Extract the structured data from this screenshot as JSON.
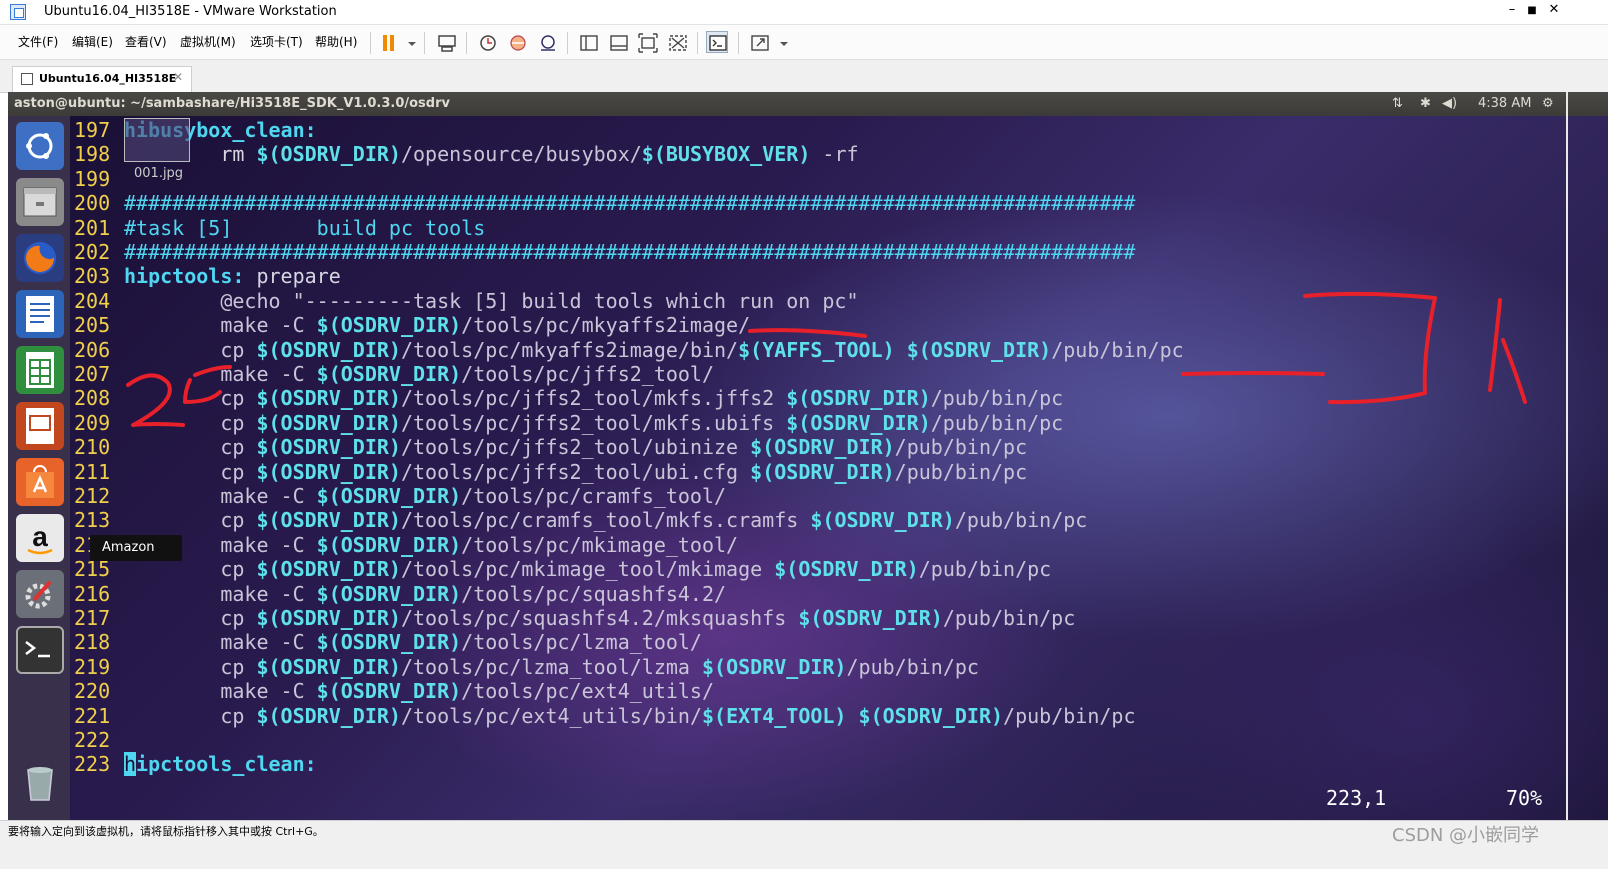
{
  "window": {
    "title": "Ubuntu16.04_HI3518E - VMware Workstation",
    "controls": [
      "–",
      "■",
      "✕"
    ]
  },
  "menu": [
    "文件(F)",
    "编辑(E)",
    "查看(V)",
    "虚拟机(M)",
    "选项卡(T)",
    "帮助(H)"
  ],
  "tab": {
    "label": "Ubuntu16.04_HI3518E",
    "close": "✕"
  },
  "ubuntu_panel": {
    "title": "aston@ubuntu: ~/sambashare/Hi3518E_SDK_V1.0.3.0/osdrv",
    "clock": "4:38 AM"
  },
  "launcher": {
    "items": [
      "ubuntu-dash",
      "files",
      "firefox",
      "writer",
      "calc",
      "impress",
      "software-center",
      "amazon",
      "system-settings",
      "terminal",
      "trash"
    ],
    "tooltip": "Amazon"
  },
  "thumbnail": {
    "label": "001.jpg"
  },
  "terminal": {
    "lines": [
      {
        "n": "197",
        "parts": [
          {
            "t": "hibusybox_clean:",
            "c": "k"
          }
        ]
      },
      {
        "n": "198",
        "parts": [
          {
            "t": "        rm ",
            "c": "w"
          },
          {
            "t": "$(OSDRV_DIR)",
            "c": "v"
          },
          {
            "t": "/opensource/busybox/",
            "c": "p"
          },
          {
            "t": "$(BUSYBOX_VER)",
            "c": "v"
          },
          {
            "t": " -rf",
            "c": "p"
          }
        ]
      },
      {
        "n": "199",
        "parts": []
      },
      {
        "n": "200",
        "parts": [
          {
            "t": "####################################################################################",
            "c": "c"
          }
        ]
      },
      {
        "n": "201",
        "parts": [
          {
            "t": "#task [5]       build pc tools",
            "c": "c"
          }
        ]
      },
      {
        "n": "202",
        "parts": [
          {
            "t": "####################################################################################",
            "c": "c"
          }
        ]
      },
      {
        "n": "203",
        "parts": [
          {
            "t": "hipctools:",
            "c": "k"
          },
          {
            "t": " prepare",
            "c": "w"
          }
        ]
      },
      {
        "n": "204",
        "parts": [
          {
            "t": "        @echo \"---------task [5] build tools which run on pc\"",
            "c": "p"
          }
        ]
      },
      {
        "n": "205",
        "parts": [
          {
            "t": "        make -C ",
            "c": "p"
          },
          {
            "t": "$(OSDRV_DIR)",
            "c": "v"
          },
          {
            "t": "/tools/pc/mkyaffs2image/",
            "c": "p"
          }
        ]
      },
      {
        "n": "206",
        "parts": [
          {
            "t": "        cp ",
            "c": "p"
          },
          {
            "t": "$(OSDRV_DIR)",
            "c": "v"
          },
          {
            "t": "/tools/pc/mkyaffs2image/bin/",
            "c": "p"
          },
          {
            "t": "$(YAFFS_TOOL)",
            "c": "v"
          },
          {
            "t": " ",
            "c": "p"
          },
          {
            "t": "$(OSDRV_DIR)",
            "c": "v"
          },
          {
            "t": "/pub/bin/pc",
            "c": "p"
          }
        ]
      },
      {
        "n": "207",
        "parts": [
          {
            "t": "        make -C ",
            "c": "p"
          },
          {
            "t": "$(OSDRV_DIR)",
            "c": "v"
          },
          {
            "t": "/tools/pc/jffs2_tool/",
            "c": "p"
          }
        ]
      },
      {
        "n": "208",
        "parts": [
          {
            "t": "        cp ",
            "c": "p"
          },
          {
            "t": "$(OSDRV_DIR)",
            "c": "v"
          },
          {
            "t": "/tools/pc/jffs2_tool/mkfs.jffs2 ",
            "c": "p"
          },
          {
            "t": "$(OSDRV_DIR)",
            "c": "v"
          },
          {
            "t": "/pub/bin/pc",
            "c": "p"
          }
        ]
      },
      {
        "n": "209",
        "parts": [
          {
            "t": "        cp ",
            "c": "p"
          },
          {
            "t": "$(OSDRV_DIR)",
            "c": "v"
          },
          {
            "t": "/tools/pc/jffs2_tool/mkfs.ubifs ",
            "c": "p"
          },
          {
            "t": "$(OSDRV_DIR)",
            "c": "v"
          },
          {
            "t": "/pub/bin/pc",
            "c": "p"
          }
        ]
      },
      {
        "n": "210",
        "parts": [
          {
            "t": "        cp ",
            "c": "p"
          },
          {
            "t": "$(OSDRV_DIR)",
            "c": "v"
          },
          {
            "t": "/tools/pc/jffs2_tool/ubinize ",
            "c": "p"
          },
          {
            "t": "$(OSDRV_DIR)",
            "c": "v"
          },
          {
            "t": "/pub/bin/pc",
            "c": "p"
          }
        ]
      },
      {
        "n": "211",
        "parts": [
          {
            "t": "        cp ",
            "c": "p"
          },
          {
            "t": "$(OSDRV_DIR)",
            "c": "v"
          },
          {
            "t": "/tools/pc/jffs2_tool/ubi.cfg ",
            "c": "p"
          },
          {
            "t": "$(OSDRV_DIR)",
            "c": "v"
          },
          {
            "t": "/pub/bin/pc",
            "c": "p"
          }
        ]
      },
      {
        "n": "212",
        "parts": [
          {
            "t": "        make -C ",
            "c": "p"
          },
          {
            "t": "$(OSDRV_DIR)",
            "c": "v"
          },
          {
            "t": "/tools/pc/cramfs_tool/",
            "c": "p"
          }
        ]
      },
      {
        "n": "213",
        "parts": [
          {
            "t": "        cp ",
            "c": "p"
          },
          {
            "t": "$(OSDRV_DIR)",
            "c": "v"
          },
          {
            "t": "/tools/pc/cramfs_tool/mkfs.cramfs ",
            "c": "p"
          },
          {
            "t": "$(OSDRV_DIR)",
            "c": "v"
          },
          {
            "t": "/pub/bin/pc",
            "c": "p"
          }
        ]
      },
      {
        "n": "214",
        "parts": [
          {
            "t": "        make -C ",
            "c": "p"
          },
          {
            "t": "$(OSDRV_DIR)",
            "c": "v"
          },
          {
            "t": "/tools/pc/mkimage_tool/",
            "c": "p"
          }
        ]
      },
      {
        "n": "215",
        "parts": [
          {
            "t": "        cp ",
            "c": "p"
          },
          {
            "t": "$(OSDRV_DIR)",
            "c": "v"
          },
          {
            "t": "/tools/pc/mkimage_tool/mkimage ",
            "c": "p"
          },
          {
            "t": "$(OSDRV_DIR)",
            "c": "v"
          },
          {
            "t": "/pub/bin/pc",
            "c": "p"
          }
        ]
      },
      {
        "n": "216",
        "parts": [
          {
            "t": "        make -C ",
            "c": "p"
          },
          {
            "t": "$(OSDRV_DIR)",
            "c": "v"
          },
          {
            "t": "/tools/pc/squashfs4.2/",
            "c": "p"
          }
        ]
      },
      {
        "n": "217",
        "parts": [
          {
            "t": "        cp ",
            "c": "p"
          },
          {
            "t": "$(OSDRV_DIR)",
            "c": "v"
          },
          {
            "t": "/tools/pc/squashfs4.2/mksquashfs ",
            "c": "p"
          },
          {
            "t": "$(OSDRV_DIR)",
            "c": "v"
          },
          {
            "t": "/pub/bin/pc",
            "c": "p"
          }
        ]
      },
      {
        "n": "218",
        "parts": [
          {
            "t": "        make -C ",
            "c": "p"
          },
          {
            "t": "$(OSDRV_DIR)",
            "c": "v"
          },
          {
            "t": "/tools/pc/lzma_tool/",
            "c": "p"
          }
        ]
      },
      {
        "n": "219",
        "parts": [
          {
            "t": "        cp ",
            "c": "p"
          },
          {
            "t": "$(OSDRV_DIR)",
            "c": "v"
          },
          {
            "t": "/tools/pc/lzma_tool/lzma ",
            "c": "p"
          },
          {
            "t": "$(OSDRV_DIR)",
            "c": "v"
          },
          {
            "t": "/pub/bin/pc",
            "c": "p"
          }
        ]
      },
      {
        "n": "220",
        "parts": [
          {
            "t": "        make -C ",
            "c": "p"
          },
          {
            "t": "$(OSDRV_DIR)",
            "c": "v"
          },
          {
            "t": "/tools/pc/ext4_utils/",
            "c": "p"
          }
        ]
      },
      {
        "n": "221",
        "parts": [
          {
            "t": "        cp ",
            "c": "p"
          },
          {
            "t": "$(OSDRV_DIR)",
            "c": "v"
          },
          {
            "t": "/tools/pc/ext4_utils/bin/",
            "c": "p"
          },
          {
            "t": "$(EXT4_TOOL)",
            "c": "v"
          },
          {
            "t": " ",
            "c": "p"
          },
          {
            "t": "$(OSDRV_DIR)",
            "c": "v"
          },
          {
            "t": "/pub/bin/pc",
            "c": "p"
          }
        ]
      },
      {
        "n": "222",
        "parts": []
      },
      {
        "n": "223",
        "parts": [
          {
            "t": "h",
            "c": "cursor"
          },
          {
            "t": "ipctools_clean:",
            "c": "k"
          }
        ]
      }
    ],
    "position": "223,1",
    "percent": "70%"
  },
  "statusbar": {
    "hint": "要将输入定向到该虚拟机，请将鼠标指针移入其中或按 Ctrl+G。",
    "watermark": "CSDN @小嵌同学"
  },
  "colors": {
    "accent": "#4fd6f0",
    "linenum": "#f0d04a",
    "annotation": "#e8202a"
  }
}
